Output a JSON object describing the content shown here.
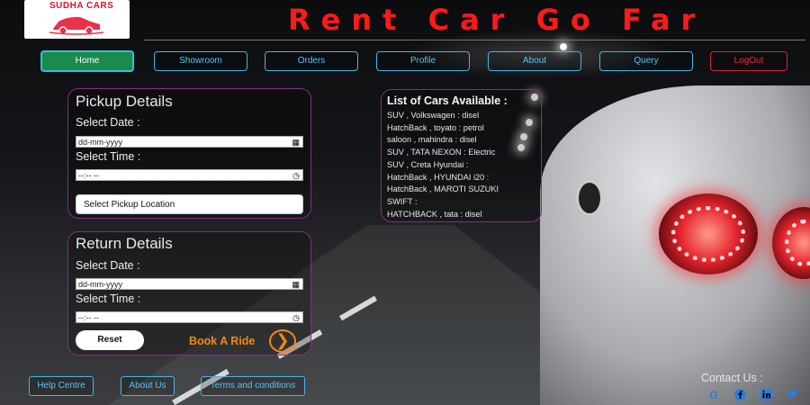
{
  "header": {
    "logo_text": "SUDHA CARS",
    "title": "Rent Car Go Far"
  },
  "nav": {
    "items": [
      "Home",
      "Showroom",
      "Orders",
      "Profile",
      "About",
      "Query",
      "LogOut"
    ],
    "active": "Home"
  },
  "pickup": {
    "title": "Pickup Details",
    "date_label": "Select Date :",
    "date_value": "dd-mm-yyyy",
    "time_label": "Select Time :",
    "time_value": "--:-- --",
    "location_button": "Select Pickup Location"
  },
  "return": {
    "title": "Return Details",
    "date_label": "Select Date :",
    "date_value": "dd-mm-yyyy",
    "time_label": "Select Time :",
    "time_value": "--:-- --",
    "reset_button": "Reset",
    "book_label": "Book A Ride"
  },
  "cars": {
    "title": "List of Cars Available :",
    "items": [
      "SUV , Volkswagen : disel",
      "HatchBack , toyato : petrol",
      "saloon , mahindra : disel",
      "SUV , TATA NEXON : Electric",
      "SUV , Creta Hyundai :",
      "HatchBack , HYUNDAI i20 :",
      "HatchBack , MAROTI SUZUKI",
      "SWIFT :",
      "HATCHBACK , tata : disel"
    ]
  },
  "footer": {
    "links": [
      "Help Centre",
      "About Us",
      "Terms and conditions"
    ],
    "contact_label": "Contact Us :",
    "social_icons": [
      "google-icon",
      "facebook-icon",
      "linkedin-icon",
      "twitter-icon"
    ]
  },
  "colors": {
    "title_red": "#ff1a1a",
    "nav_blue": "#46b6e6",
    "active_green": "#1a8a4d",
    "logout_red": "#d8232c",
    "panel_border": "#8b2b87",
    "book_orange": "#f08a14",
    "social_blue": "#2a7de1"
  }
}
